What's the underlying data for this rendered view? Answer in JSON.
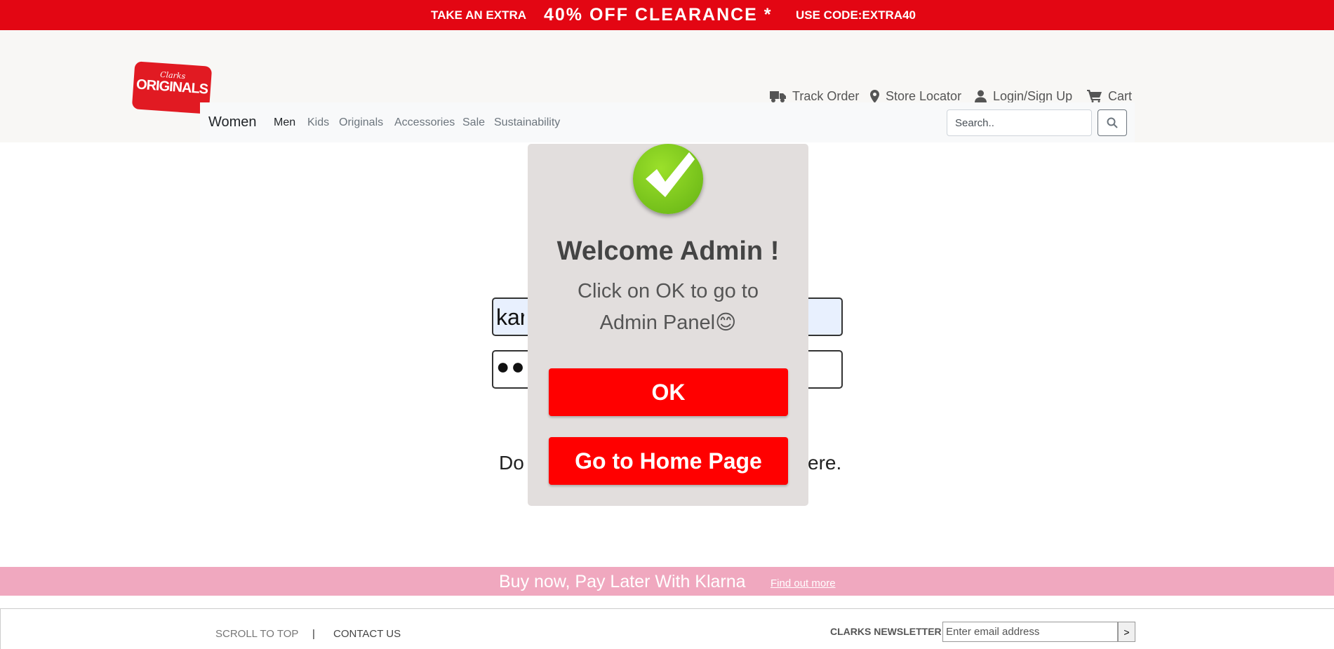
{
  "promo": {
    "left": "TAKE AN EXTRA",
    "center": "40% OFF CLEARANCE *",
    "right": "USE CODE:EXTRA40"
  },
  "logo": {
    "top": "Clarks",
    "main": "ORIGINALS"
  },
  "utility_nav": [
    {
      "label": "Track Order",
      "icon": "truck-icon"
    },
    {
      "label": "Store Locator",
      "icon": "map-pin-icon"
    },
    {
      "label": "Login/Sign Up",
      "icon": "user-icon"
    },
    {
      "label": "Cart",
      "icon": "cart-icon"
    }
  ],
  "navbar": {
    "brand": "Women",
    "items": [
      "Men",
      "Kids",
      "Originals",
      "Accessories",
      "Sale",
      "Sustainability"
    ],
    "search_placeholder": "Search.."
  },
  "login_form": {
    "username_value": "kar",
    "password_masked": "●●●●",
    "signup_prefix": "Do",
    "signup_suffix": "ere."
  },
  "modal": {
    "icon": "check-icon",
    "title": "Welcome Admin !",
    "message": "Click on OK to go to Admin Panel😊",
    "ok_label": "OK",
    "home_label": "Go to Home Page"
  },
  "klarna": {
    "text": "Buy now, Pay Later With Klarna",
    "link": "Find out more"
  },
  "footer": {
    "scroll_top": "SCROLL TO TOP",
    "separator": "|",
    "contact": "CONTACT US",
    "newsletter_label": "CLARKS NEWSLETTER",
    "email_placeholder": "Enter email address",
    "submit_label": ">"
  },
  "colors": {
    "promo": "#e30613",
    "modal_button": "#ff0000",
    "klarna": "#f0a8bf",
    "modal_bg": "#e2dedd"
  }
}
